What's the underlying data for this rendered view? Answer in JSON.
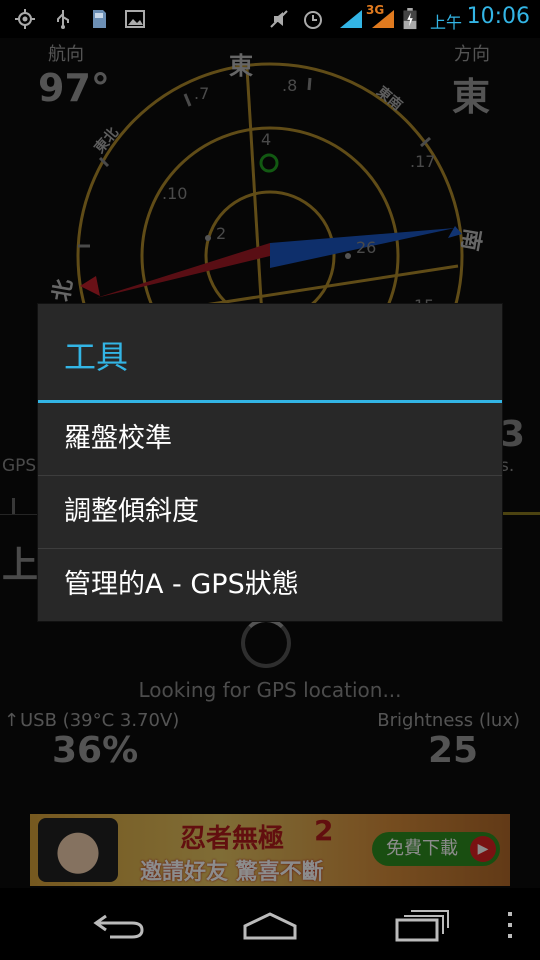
{
  "status_bar": {
    "icons": [
      "gps-icon",
      "usb-icon",
      "sd-card-icon",
      "image-icon",
      "mute-icon",
      "alarm-icon",
      "signal-icon",
      "3g-signal-icon",
      "battery-charging-icon"
    ],
    "network_label": "3G",
    "ampm": "上午",
    "time": "10:06"
  },
  "compass": {
    "heading_label": "航向",
    "heading_value": "97°",
    "direction_label": "方向",
    "direction_value": "東",
    "cardinals": {
      "north": "北",
      "east": "東",
      "south": "南"
    },
    "intercardinals": {
      "northeast": "東北",
      "southeast": "東南"
    },
    "satellites": [
      ".7",
      ".8",
      "4",
      ".10",
      ".17",
      "2",
      "26",
      "15"
    ]
  },
  "partial_texts": {
    "left_gps": "GPS",
    "right_s": "s.",
    "right_digit": "3",
    "left_big": "上"
  },
  "status_message": "Looking for GPS location...",
  "battery": {
    "label": "USB (39°C 3.70V)",
    "value": "36%"
  },
  "brightness": {
    "label": "Brightness (lux)",
    "value": "25"
  },
  "ad": {
    "title": "忍者無極",
    "title_num": "2",
    "subtitle": "邀請好友  驚喜不斷",
    "button": "免費下載"
  },
  "dialog": {
    "title": "工具",
    "items": [
      {
        "label": "羅盤校準"
      },
      {
        "label": "調整傾斜度"
      },
      {
        "label": "管理的A - GPS狀態"
      }
    ]
  },
  "nav": {
    "buttons": [
      "back-icon",
      "home-icon",
      "recent-apps-icon",
      "overflow-menu-icon"
    ]
  },
  "colors": {
    "accent": "#33b5e5",
    "compass_ring": "#c49a2c",
    "needle_north": "#c0202a",
    "needle_south": "#2060d0",
    "satellite_green": "#21a321"
  }
}
